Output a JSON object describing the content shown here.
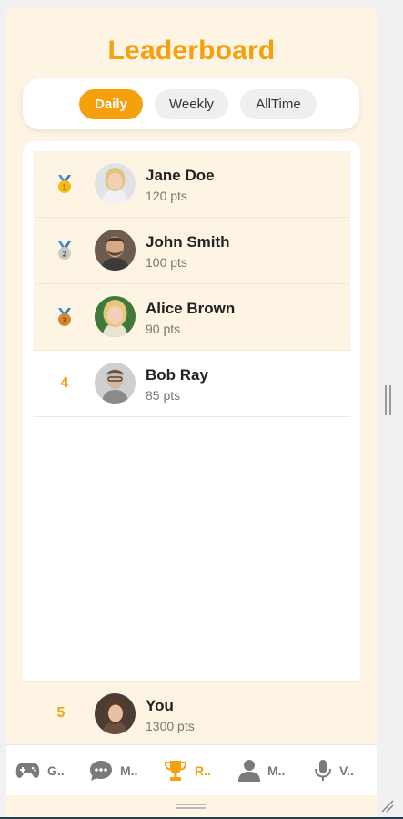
{
  "title": "Leaderboard",
  "tabs": [
    {
      "label": "Daily",
      "active": true
    },
    {
      "label": "Weekly",
      "active": false
    },
    {
      "label": "AllTime",
      "active": false
    }
  ],
  "entries": [
    {
      "rank": "1",
      "medal": "gold",
      "name": "Jane Doe",
      "points": "120 pts"
    },
    {
      "rank": "2",
      "medal": "silver",
      "name": "John Smith",
      "points": "100 pts"
    },
    {
      "rank": "3",
      "medal": "bronze",
      "name": "Alice Brown",
      "points": "90 pts"
    },
    {
      "rank": "4",
      "medal": null,
      "name": "Bob Ray",
      "points": "85 pts"
    }
  ],
  "you": {
    "rank": "5",
    "name": "You",
    "points": "1300 pts"
  },
  "nav": [
    {
      "label": "G..",
      "icon": "gamepad-icon",
      "active": false
    },
    {
      "label": "M..",
      "icon": "chat-icon",
      "active": false
    },
    {
      "label": "R..",
      "icon": "trophy-icon",
      "active": true
    },
    {
      "label": "M..",
      "icon": "person-icon",
      "active": false
    },
    {
      "label": "V..",
      "icon": "microphone-icon",
      "active": false
    }
  ],
  "colors": {
    "accent": "#f5a00d",
    "highlight": "#fdf4e3",
    "gold": "#f5b90f",
    "silver": "#c9c9c9",
    "bronze": "#d6892e",
    "ribbon": "#3a8fd6"
  }
}
